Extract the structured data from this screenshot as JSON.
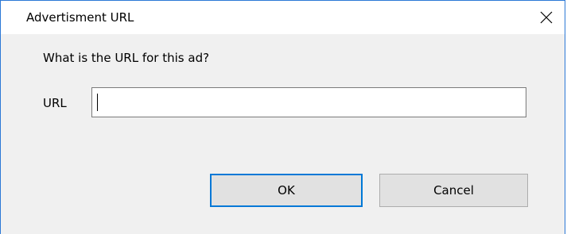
{
  "dialog": {
    "title": "Advertisment URL",
    "close_icon": "close-icon",
    "prompt": "What is the URL for this ad?",
    "url_label": "URL",
    "url_value": "",
    "ok_label": "OK",
    "cancel_label": "Cancel"
  },
  "colors": {
    "window_border": "#2b78d6",
    "titlebar_bg": "#ffffff",
    "body_bg": "#f0f0f0",
    "button_bg": "#e1e1e1",
    "default_button_border": "#0078d7"
  }
}
